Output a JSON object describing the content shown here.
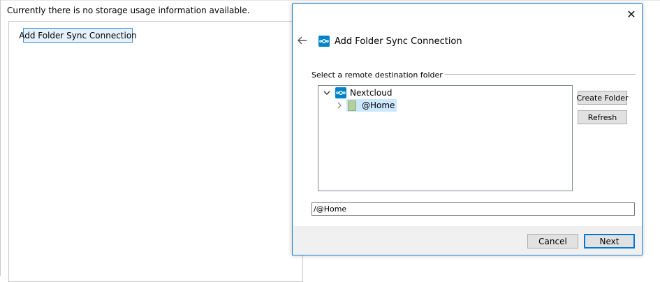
{
  "background": {
    "storage_info": "Currently there is no storage usage information available.",
    "add_button_label": "Add Folder Sync Connection"
  },
  "dialog": {
    "title": "Add Folder Sync Connection",
    "close_icon": "close-icon",
    "back_icon": "back-arrow-icon",
    "group_label": "Select a remote destination folder",
    "tree": {
      "root": {
        "label": "Nextcloud",
        "icon": "nextcloud-icon",
        "expanded": true
      },
      "children": [
        {
          "label": "@Home",
          "icon": "folder-icon",
          "selected": true
        }
      ]
    },
    "buttons": {
      "create_folder": "Create Folder",
      "refresh": "Refresh"
    },
    "path_value": "/@Home",
    "footer": {
      "cancel": "Cancel",
      "next": "Next"
    }
  },
  "colors": {
    "accent": "#0078d7",
    "nextcloud_blue": "#0082c9",
    "selection": "#cce8ff",
    "footer_bg": "#f0f0f0"
  }
}
